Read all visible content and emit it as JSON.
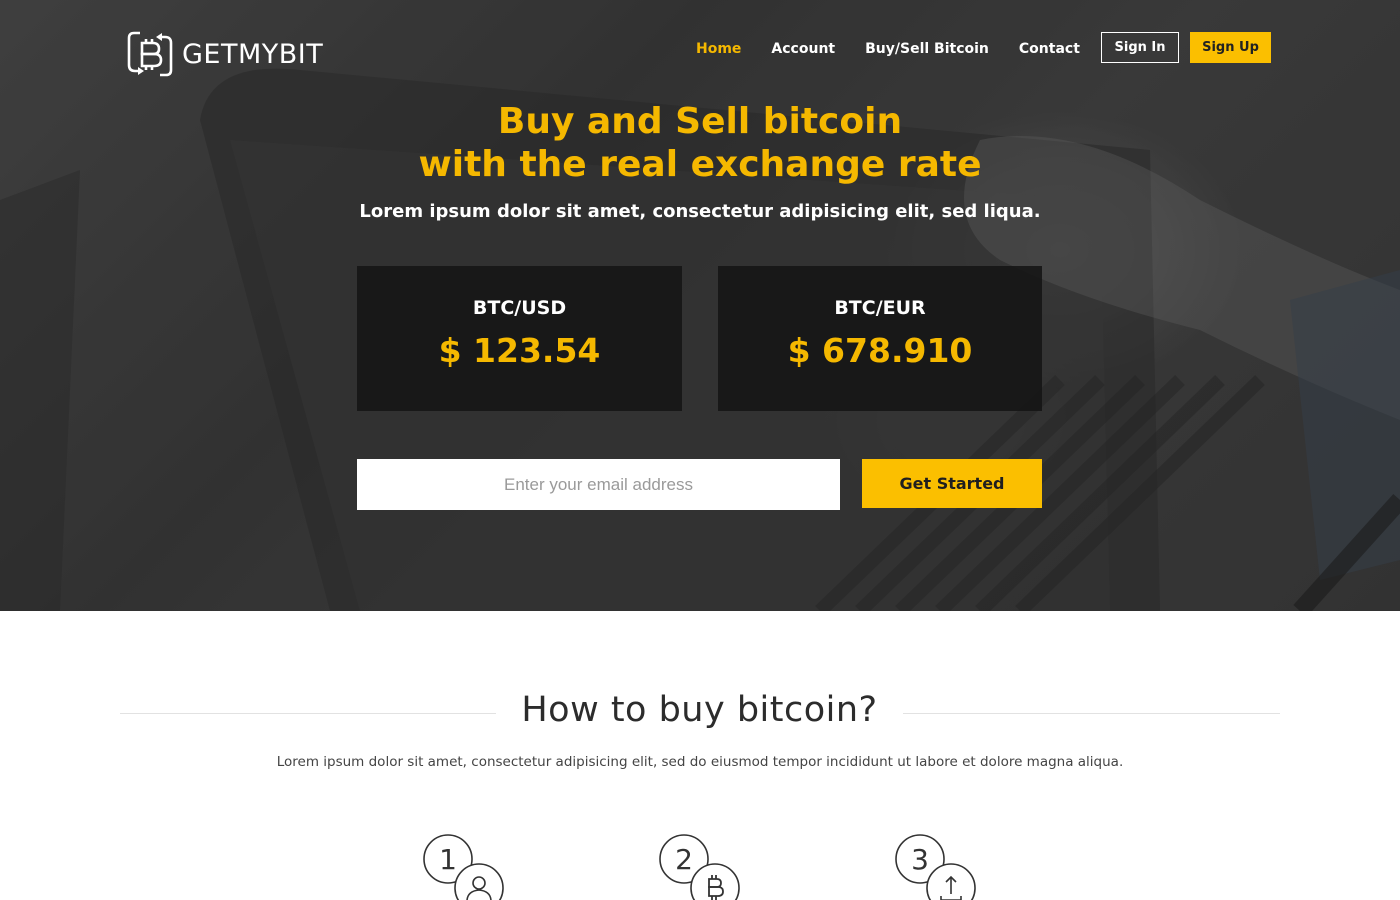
{
  "brand": {
    "name": "GETMYBIT",
    "logo_icon": "bitcoin-exchange-icon"
  },
  "nav": {
    "items": [
      {
        "label": "Home",
        "active": true
      },
      {
        "label": "Account",
        "active": false
      },
      {
        "label": "Buy/Sell Bitcoin",
        "active": false
      },
      {
        "label": "Contact",
        "active": false
      }
    ],
    "sign_in": "Sign In",
    "sign_up": "Sign Up"
  },
  "hero": {
    "title_line1": "Buy and Sell bitcoin",
    "title_line2": "with the real exchange rate",
    "subtitle": "Lorem ipsum dolor sit amet, consectetur adipisicing elit, sed liqua.",
    "rates": [
      {
        "pair": "BTC/USD",
        "value": "$ 123.54"
      },
      {
        "pair": "BTC/EUR",
        "value": "$ 678.910"
      }
    ],
    "email_placeholder": "Enter your email address",
    "cta_label": "Get Started"
  },
  "how_to": {
    "title": "How to buy bitcoin?",
    "subtitle": "Lorem ipsum dolor sit amet, consectetur adipisicing elit, sed do eiusmod tempor incididunt ut labore et dolore magna aliqua.",
    "steps": [
      {
        "number": "1",
        "icon": "user-icon"
      },
      {
        "number": "2",
        "icon": "bitcoin-icon"
      },
      {
        "number": "3",
        "icon": "upload-icon"
      }
    ]
  },
  "colors": {
    "accent": "#fbbf00",
    "accent_text": "#f5b800",
    "hero_overlay": "#3c3c3c",
    "card_bg": "#161616"
  }
}
